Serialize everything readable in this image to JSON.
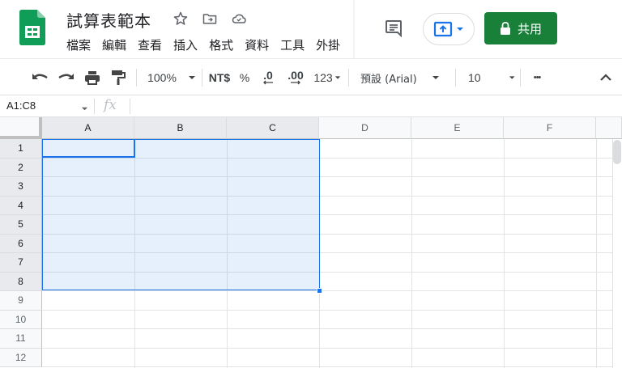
{
  "app": {
    "title": "試算表範本",
    "menu": [
      "檔案",
      "編輯",
      "查看",
      "插入",
      "格式",
      "資料",
      "工具",
      "外掛"
    ],
    "share_label": "共用"
  },
  "toolbar": {
    "zoom": "100%",
    "currency": "NT$",
    "percent": "%",
    "dec_decrease": ".0",
    "dec_increase": ".00",
    "format_more": "123",
    "font": "預設 (Arial)",
    "font_size": "10",
    "more": "•••"
  },
  "formula_bar": {
    "name_box": "A1:C8",
    "fx": "fx"
  },
  "grid": {
    "columns": [
      "A",
      "B",
      "C",
      "D",
      "E",
      "F"
    ],
    "rows": [
      "1",
      "2",
      "3",
      "4",
      "5",
      "6",
      "7",
      "8",
      "9",
      "10",
      "11",
      "12"
    ],
    "selected_columns": [
      "A",
      "B",
      "C"
    ],
    "selected_rows": [
      "1",
      "2",
      "3",
      "4",
      "5",
      "6",
      "7",
      "8"
    ],
    "selection_range": "A1:C8"
  },
  "colors": {
    "brand_green": "#188038",
    "selection_blue": "#1a73e8",
    "sheets_logo": "#0f9d58"
  }
}
